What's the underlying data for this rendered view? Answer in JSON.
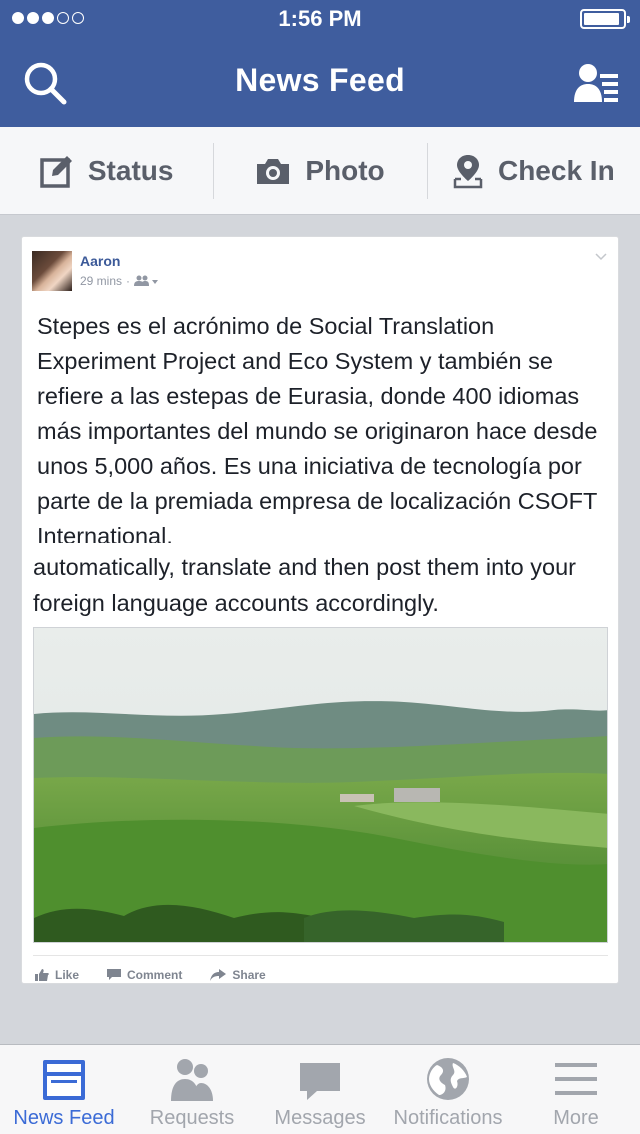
{
  "status_bar": {
    "time": "1:56 PM",
    "signal_dots_filled": 3,
    "signal_dots_total": 5,
    "battery_level": 0.92
  },
  "header": {
    "title": "News Feed",
    "search_icon": "search-icon",
    "friends_icon": "friends-list-icon"
  },
  "composer": {
    "status_label": "Status",
    "photo_label": "Photo",
    "checkin_label": "Check In"
  },
  "post": {
    "author": "Aaron",
    "time": "29 mins",
    "audience_icon": "friends-audience-icon",
    "text": "Stepes es el acrónimo de Social Translation Experiment Project and Eco System y también se refiere a las estepas de Eurasia, donde 400 idiomas más importantes del mundo se originaron hace desde unos 5,000 años. Es una iniciativa de tecnología por parte de la premiada empresa de localización CSOFT International.",
    "text_underlay": "automatically, translate and then post them into your foreign language accounts accordingly.",
    "actions": {
      "like": "Like",
      "comment": "Comment",
      "share": "Share"
    }
  },
  "tabbar": {
    "tabs": [
      {
        "label": "News Feed",
        "icon": "news-feed-icon",
        "active": true
      },
      {
        "label": "Requests",
        "icon": "requests-icon",
        "active": false
      },
      {
        "label": "Messages",
        "icon": "messages-icon",
        "active": false
      },
      {
        "label": "Notifications",
        "icon": "notifications-globe-icon",
        "active": false
      },
      {
        "label": "More",
        "icon": "more-menu-icon",
        "active": false
      }
    ]
  },
  "colors": {
    "brand": "#3f5d9e",
    "link": "#3b5998",
    "active_tab": "#3b6bd6",
    "inactive": "#a2a6ad"
  }
}
